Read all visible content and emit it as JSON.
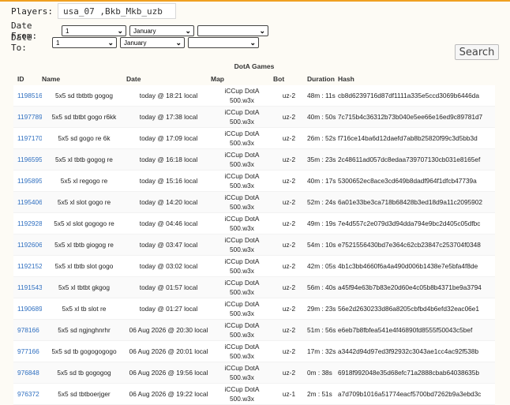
{
  "filters": {
    "players_label": "Players:",
    "players_value": "usa_07 ,Bkb_Mkb_uzb",
    "date_from_label": "Date From:",
    "date_to_label": "Date To:",
    "from_day": "1",
    "from_month": "January",
    "from_year": "",
    "to_day": "1",
    "to_month": "January",
    "to_year": "",
    "search_label": "Search"
  },
  "table": {
    "caption": "DotA Games",
    "headers": {
      "id": "ID",
      "name": "Name",
      "date": "Date",
      "map": "Map",
      "bot": "Bot",
      "duration": "Duration",
      "hash": "Hash"
    },
    "rows": [
      {
        "id": "1198516",
        "name": "5x5 sd tbtbtb gogog",
        "date": "today @ 18:21 local",
        "map1": "iCCup DotA",
        "map2": "500.w3x",
        "bot": "uz-2",
        "duration": "48m : 11s",
        "hash": "cb8d6239716d87df1111a335e5ccd3069b6446da"
      },
      {
        "id": "1197789",
        "name": "5x5 sd tbtbt gogo r6kk",
        "date": "today @ 17:38 local",
        "map1": "iCCup DotA",
        "map2": "500.w3x",
        "bot": "uz-2",
        "duration": "40m : 50s",
        "hash": "7c715b4c36312b73b040e5ee66e16ed9c89781d7"
      },
      {
        "id": "1197170",
        "name": "5x5 sd gogo re 6k",
        "date": "today @ 17:09 local",
        "map1": "iCCup DotA",
        "map2": "500.w3x",
        "bot": "uz-2",
        "duration": "26m : 52s",
        "hash": "f716ce14ba6d12daefd7ab8b25820f99c3d5bb3d"
      },
      {
        "id": "1196595",
        "name": "5x5 xl tbtb gogog re",
        "date": "today @ 16:18 local",
        "map1": "iCCup DotA",
        "map2": "500.w3x",
        "bot": "uz-2",
        "duration": "35m : 23s",
        "hash": "2c48611ad057dc8edaa739707130cb031e8165ef"
      },
      {
        "id": "1195895",
        "name": "5x5 xl regogo re",
        "date": "today @ 15:16 local",
        "map1": "iCCup DotA",
        "map2": "500.w3x",
        "bot": "uz-2",
        "duration": "40m : 17s",
        "hash": "5300652ec8ace3cd649b8dadf964f1dfcb47739a"
      },
      {
        "id": "1195406",
        "name": "5x5 xl slot gogo re",
        "date": "today @ 14:20 local",
        "map1": "iCCup DotA",
        "map2": "500.w3x",
        "bot": "uz-2",
        "duration": "52m : 24s",
        "hash": "6a01e33be3ca718b68428b3ed18d9a11c2095902"
      },
      {
        "id": "1192928",
        "name": "5x5 xl slot gogogo re",
        "date": "today @ 04:46 local",
        "map1": "iCCup DotA",
        "map2": "500.w3x",
        "bot": "uz-2",
        "duration": "49m : 19s",
        "hash": "7e4d557c2e079d3d94dda794e9bc2d405c05dfbc"
      },
      {
        "id": "1192606",
        "name": "5x5 xl tbtb giogog re",
        "date": "today @ 03:47 local",
        "map1": "iCCup DotA",
        "map2": "500.w3x",
        "bot": "uz-2",
        "duration": "54m : 10s",
        "hash": "e7521556430bd7e364c62cb23847c253704f0348"
      },
      {
        "id": "1192152",
        "name": "5x5 xl tbtb slot gogo",
        "date": "today @ 03:02 local",
        "map1": "iCCup DotA",
        "map2": "500.w3x",
        "bot": "uz-2",
        "duration": "42m : 05s",
        "hash": "4b1c3bb4660f6a4a490d006b1438e7e5bfa4f8de"
      },
      {
        "id": "1191543",
        "name": "5x5 xl tbtbt gkgog",
        "date": "today @ 01:57 local",
        "map1": "iCCup DotA",
        "map2": "500.w3x",
        "bot": "uz-2",
        "duration": "56m : 40s",
        "hash": "a45f94e63b7b83e20d60e4c05b8b4371be9a3794"
      },
      {
        "id": "1190689",
        "name": "5x5 xl tb slot re",
        "date": "today @ 01:27 local",
        "map1": "iCCup DotA",
        "map2": "500.w3x",
        "bot": "uz-2",
        "duration": "29m : 23s",
        "hash": "56e2d2630233d86a8205cbfbd4b6efd32eac06e1"
      },
      {
        "id": "978166",
        "name": "5x5 sd ngjnghnrhr",
        "date": "06 Aug 2026 @ 20:30 local",
        "map1": "iCCup DotA",
        "map2": "500.w3x",
        "bot": "uz-2",
        "duration": "51m : 56s",
        "hash": "e6eb7b8fbfea541e4f46890fd8555f50043c5bef"
      },
      {
        "id": "977166",
        "name": "5x5 sd tb gogogogogo",
        "date": "06 Aug 2026 @ 20:01 local",
        "map1": "iCCup DotA",
        "map2": "500.w3x",
        "bot": "uz-2",
        "duration": "17m : 32s",
        "hash": "a3442d94d97ed3f92932c3043ae1cc4ac92f538b"
      },
      {
        "id": "976848",
        "name": "5x5 sd tb gogogog",
        "date": "06 Aug 2026 @ 19:56 local",
        "map1": "iCCup DotA",
        "map2": "500.w3x",
        "bot": "uz-2",
        "duration": "0m : 38s",
        "hash": "6918f992048e35d68efc71a2888cbab64038635b"
      },
      {
        "id": "976372",
        "name": "5x5 sd tbtboerjger",
        "date": "06 Aug 2026 @ 19:22 local",
        "map1": "iCCup DotA",
        "map2": "500.w3x",
        "bot": "uz-1",
        "duration": "2m : 51s",
        "hash": "a7d709b1016a51774eacf5700bd7262b9a3ebd3c"
      }
    ]
  }
}
